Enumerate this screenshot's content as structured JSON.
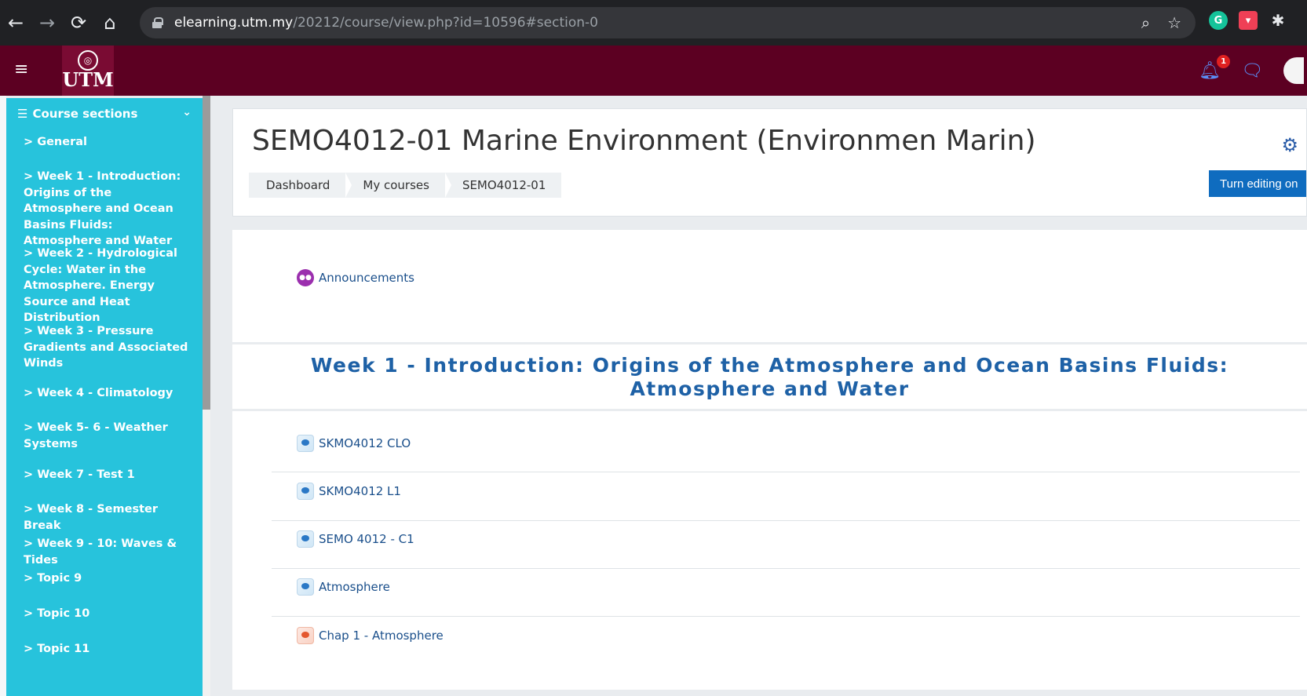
{
  "browser": {
    "url_domain": "elearning.utm.my",
    "url_path": "/20212/course/view.php?id=10596#section-0"
  },
  "navbar": {
    "logo_text": "UTM",
    "notification_count": "1"
  },
  "sidebar": {
    "header": "Course sections",
    "items": [
      {
        "label": "> General"
      },
      {
        "label": "> Week 1 - Introduction: Origins of the Atmosphere and Ocean Basins Fluids: Atmosphere and Water"
      },
      {
        "label": "> Week 2 - Hydrological Cycle: Water in the Atmosphere. Energy Source and Heat Distribution"
      },
      {
        "label": "> Week 3 - Pressure Gradients and Associated Winds"
      },
      {
        "label": "> Week 4 - Climatology"
      },
      {
        "label": "> Week 5- 6 - Weather Systems"
      },
      {
        "label": "> Week 7 - Test 1"
      },
      {
        "label": "> Week 8 - Semester Break"
      },
      {
        "label": "> Week 9 - 10: Waves & Tides"
      },
      {
        "label": "> Topic 9"
      },
      {
        "label": "> Topic 10"
      },
      {
        "label": "> Topic 11"
      }
    ]
  },
  "header": {
    "course_title": "SEMO4012-01 Marine Environment (Environmen Marin)",
    "breadcrumb": [
      "Dashboard",
      "My courses",
      "SEMO4012-01"
    ],
    "edit_button": "Turn editing on"
  },
  "announcements": {
    "label": "Announcements"
  },
  "week1": {
    "title": "Week 1 - Introduction: Origins of the Atmosphere and Ocean Basins Fluids: Atmosphere and Water",
    "activities": [
      {
        "label": "SKMO4012 CLO",
        "icon": "file-icon"
      },
      {
        "label": "SKMO4012 L1",
        "icon": "file-icon"
      },
      {
        "label": "SEMO 4012 - C1",
        "icon": "file-icon"
      },
      {
        "label": "Atmosphere",
        "icon": "file-icon"
      },
      {
        "label": "Chap 1 - Atmosphere",
        "icon": "pdf-icon"
      }
    ]
  },
  "colors": {
    "navbar": "#5c0022",
    "sidebar": "#27c3dc",
    "link": "#1a4f8b",
    "section_title": "#1e61a6",
    "button": "#0f6cbf"
  }
}
